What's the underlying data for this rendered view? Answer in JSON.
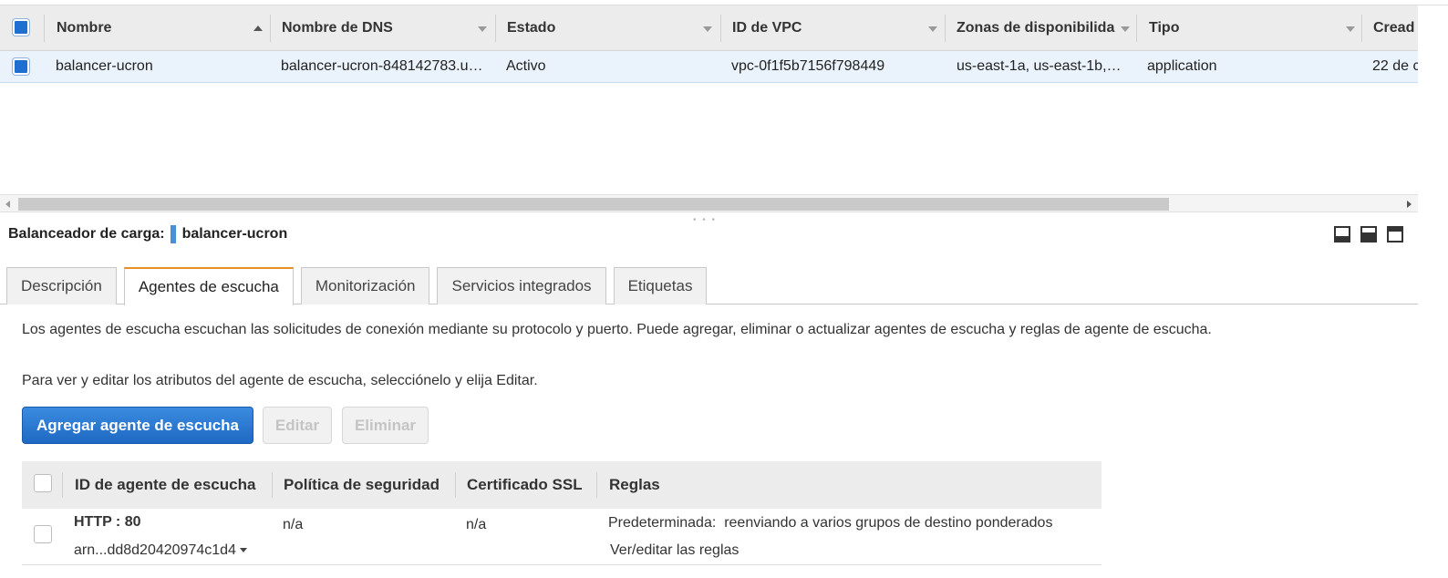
{
  "lb_table": {
    "columns": [
      {
        "label": "Nombre"
      },
      {
        "label": "Nombre de DNS"
      },
      {
        "label": "Estado"
      },
      {
        "label": "ID de VPC"
      },
      {
        "label": "Zonas de disponibilida"
      },
      {
        "label": "Tipo"
      },
      {
        "label": "Cread"
      }
    ],
    "row": {
      "name": "balancer-ucron",
      "dns": "balancer-ucron-848142783.u…",
      "state": "Activo",
      "vpc": "vpc-0f1f5b7156f798449",
      "zones": "us-east-1a, us-east-1b,…",
      "type": "application",
      "created": "22 de c"
    }
  },
  "detail": {
    "title_label": "Balanceador de carga:",
    "title_name": "balancer-ucron",
    "tabs": [
      {
        "label": "Descripción"
      },
      {
        "label": "Agentes de escucha"
      },
      {
        "label": "Monitorización"
      },
      {
        "label": "Servicios integrados"
      },
      {
        "label": "Etiquetas"
      }
    ],
    "active_tab": "Agentes de escucha",
    "paragraph1": "Los agentes de escucha escuchan las solicitudes de conexión mediante su protocolo y puerto. Puede agregar, eliminar o actualizar agentes de escucha y reglas de agente de escucha.",
    "paragraph2": "Para ver y editar los atributos del agente de escucha, selecciónelo y elija Editar.",
    "buttons": {
      "add": "Agregar agente de escucha",
      "edit": "Editar",
      "delete": "Eliminar"
    }
  },
  "listeners": {
    "columns": [
      {
        "label": "ID de agente de escucha"
      },
      {
        "label": "Política de seguridad"
      },
      {
        "label": "Certificado SSL"
      },
      {
        "label": "Reglas"
      }
    ],
    "row": {
      "protocol_port": "HTTP : 80",
      "arn": "arn...dd8d20420974c1d4",
      "policy": "n/a",
      "certificate": "n/a",
      "rule_label": "Predeterminada:",
      "rule_text": "reenviando a varios grupos de destino ponderados",
      "rule_link": "Ver/editar las reglas"
    }
  },
  "icons": {
    "layout": [
      "layout-bottom-icon",
      "layout-split-icon",
      "layout-top-icon"
    ]
  },
  "colors": {
    "primary": "#1f6fd1",
    "active_tab_accent": "#e88f24",
    "link": "#1f6fc5"
  }
}
